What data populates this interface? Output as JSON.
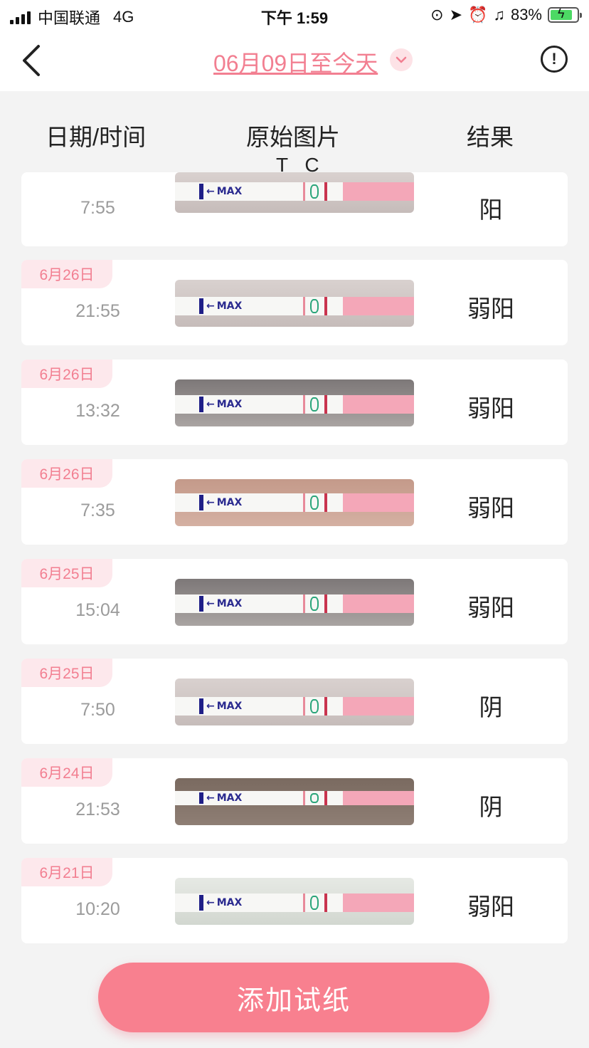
{
  "status_bar": {
    "carrier": "中国联通",
    "network": "4G",
    "time": "下午 1:59",
    "battery": "83%"
  },
  "nav": {
    "title": "06月09日至今天",
    "back_icon": "chevron-left-icon",
    "dropdown_icon": "chevron-down-icon",
    "info_icon": "exclamation-circle-icon"
  },
  "columns": {
    "datetime": "日期/时间",
    "image": "原始图片",
    "image_sub": "T C",
    "result": "结果"
  },
  "records": [
    {
      "date": "",
      "time": "7:55",
      "result": "阳"
    },
    {
      "date": "6月26日",
      "time": "21:55",
      "result": "弱阳"
    },
    {
      "date": "6月26日",
      "time": "13:32",
      "result": "弱阳"
    },
    {
      "date": "6月26日",
      "time": "7:35",
      "result": "弱阳"
    },
    {
      "date": "6月25日",
      "time": "15:04",
      "result": "弱阳"
    },
    {
      "date": "6月25日",
      "time": "7:50",
      "result": "阴"
    },
    {
      "date": "6月24日",
      "time": "21:53",
      "result": "阴"
    },
    {
      "date": "6月21日",
      "time": "10:20",
      "result": "弱阳"
    }
  ],
  "strip_text": "MAX",
  "add_button": "添加试纸",
  "colors": {
    "accent": "#f27f91",
    "button": "#f8808f",
    "badge_bg": "#fde8ec",
    "background": "#f3f3f3"
  }
}
